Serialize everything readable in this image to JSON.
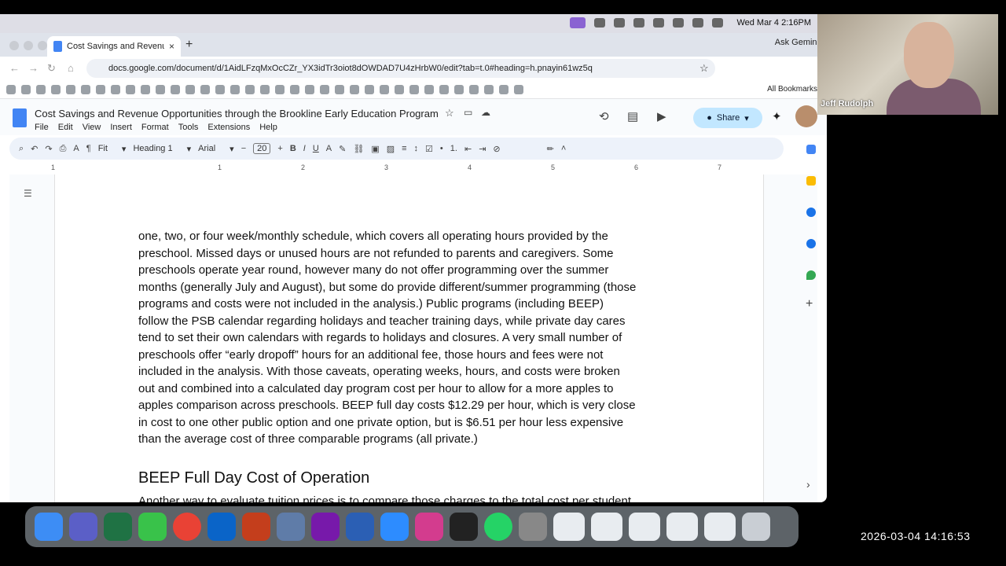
{
  "menubar": {
    "datetime": "Wed Mar 4  2:16PM"
  },
  "browser": {
    "tab_title": "Cost Savings and Revenue O",
    "gemini": "Ask Gemini",
    "url": "docs.google.com/document/d/1AidLFzqMxOcCZr_YX3idTr3oiot8dOWDAD7U4zHrbW0/edit?tab=t.0#heading=h.pnayin61wz5q",
    "all_bookmarks": "All Bookmarks"
  },
  "docs": {
    "title": "Cost Savings and Revenue Opportunities through the Brookline Early Education Program",
    "menus": [
      "File",
      "Edit",
      "View",
      "Insert",
      "Format",
      "Tools",
      "Extensions",
      "Help"
    ],
    "share": "Share",
    "toolbar": {
      "zoom": "Fit",
      "style": "Heading 1",
      "font": "Arial",
      "size": "20"
    },
    "ruler": [
      "1",
      "1",
      "2",
      "3",
      "4",
      "5",
      "6",
      "7"
    ],
    "body_lines": [
      "one, two, or four week/monthly schedule, which covers all operating hours provided by the",
      "preschool.  Missed days or unused hours are not refunded to parents and caregivers.  Some",
      "preschools operate year round, however many do not offer programming over the summer",
      "months (generally July and August), but some do provide different/summer programming (those",
      "programs and costs were not included in the analysis.)  Public programs (including BEEP)",
      "follow the PSB calendar regarding holidays and teacher training days, while private day cares",
      "tend to set their own calendars with regards to holidays and closures.  A very small number of",
      "preschools offer “early dropoff” hours for an additional fee, those hours and fees were not",
      "included in the analysis.  With those caveats, operating weeks, hours, and costs were broken",
      "out and combined into a calculated day program cost per hour to allow for a more apples to",
      "apples comparison across preschools.  BEEP full day costs $12.29 per hour, which is very close",
      "in cost to one other public option and one private option, but is $6.51 per hour less expensive",
      "than the average cost of three comparable programs (all private.)"
    ],
    "heading": "BEEP Full Day Cost of Operation",
    "next_line": "Another way to evaluate tuition prices is to compare those charges to the total cost per student"
  },
  "webcam": {
    "name": "Jeff Rudolph"
  },
  "timestamp": "2026-03-04  14:16:53",
  "colors": {
    "accent": "#4285f4",
    "share_bg": "#c2e7ff",
    "toolbar_bg": "#edf2fa"
  }
}
